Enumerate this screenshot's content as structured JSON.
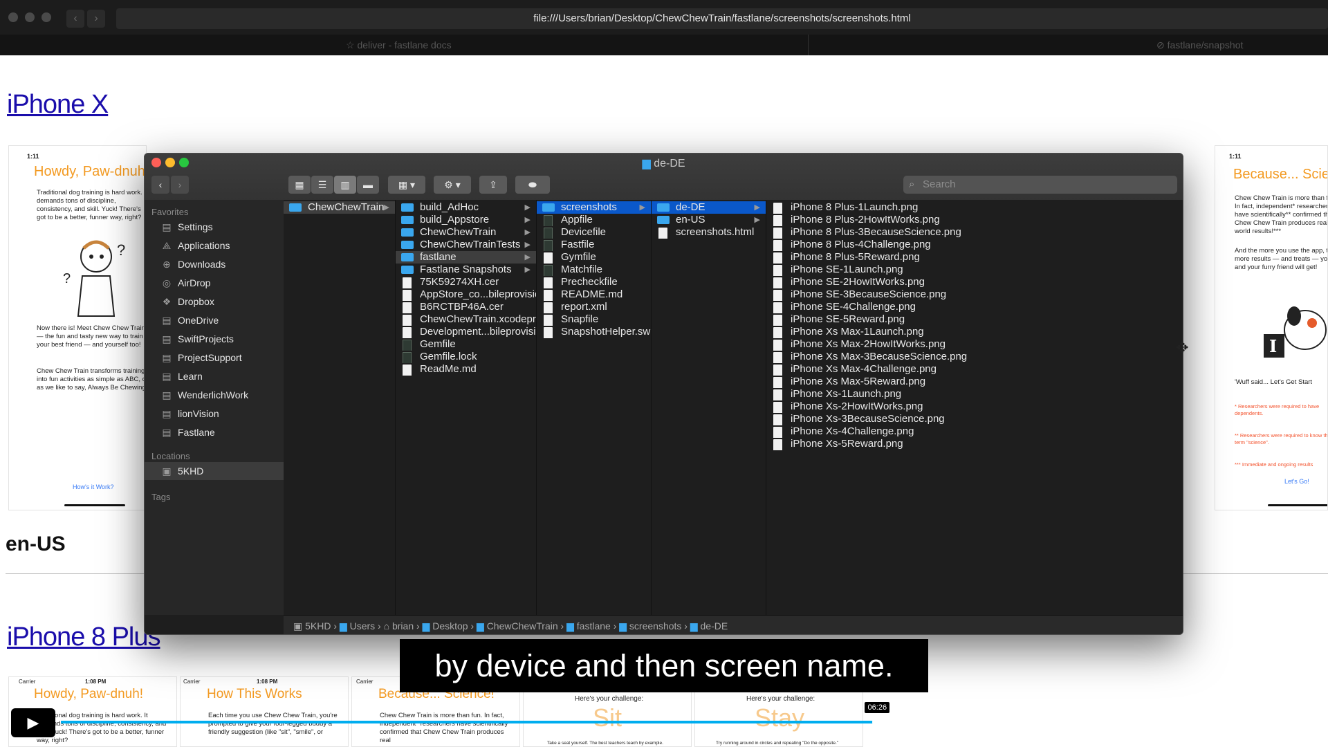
{
  "browser": {
    "url": "file:///Users/brian/Desktop/ChewChewTrain/fastlane/screenshots/screenshots.html",
    "tabs": [
      {
        "label": "deliver - fastlane docs"
      },
      {
        "label": "fastlane/snapshot"
      }
    ]
  },
  "page": {
    "section1_title": "iPhone X",
    "section2_title": "en-US",
    "section3_title": "iPhone 8 Plus",
    "cards_top": [
      {
        "time": "1:11",
        "title": "Howdy, Paw-dnuh",
        "para1": "Traditional dog training is hard work. It demands tons of discipline, consistency, and skill. Yuck! There's got to be a better, funner way, right?",
        "para2": "Now there is! Meet Chew Chew Train — the fun and tasty new way to train your best friend — and yourself too!",
        "para3": "Chew Chew Train transforms training into fun activities as simple as ABC, or as we like to say, Always Be Chewing!",
        "link": "How's it Work?"
      },
      {
        "time": "1:11",
        "title": "Because... Scie",
        "para1": "Chew Chew Train is more than fun. In fact, independent* researchers have scientifically** confirmed that Chew Chew Train produces real world results!***",
        "para2": "And the more you use the app, the more results — and treats — you and your furry friend will get!",
        "quote": "'Wuff said... Let's Get Start",
        "note1": "* Researchers were required to have dependents.",
        "note2": "** Researchers were required to know the term \"science\".",
        "note3": "*** Immediate and ongoing results",
        "link": "Let's Go!"
      }
    ],
    "cards_bottom": [
      {
        "carrier": "Carrier",
        "time": "1:08 PM",
        "title": "Howdy, Paw-dnuh!",
        "text": "Traditional dog training is hard work. It demands tons of discipline, consistency, and skill. Yuck! There's got to be a better, funner way, right?"
      },
      {
        "carrier": "Carrier",
        "time": "1:08 PM",
        "title": "How This Works",
        "text": "Each time you use Chew Chew Train, you're prompted to give your four-legged buddy a friendly suggestion (like \"sit\", \"smile\", or"
      },
      {
        "carrier": "Carrier",
        "time": "",
        "title": "Because... Science!",
        "text": "Chew Chew Train is more than fun. In fact, independent* researchers have scientifically** confirmed that Chew Chew Train produces real"
      },
      {
        "header": "Here's your challenge:",
        "big": "Sit",
        "foot": "Take a seat yourself. The best teachers teach by example."
      },
      {
        "header": "Here's your challenge:",
        "big": "Stay",
        "foot": "Try running around in circles and repeating \"Do the opposite.\""
      }
    ]
  },
  "finder": {
    "title": "de-DE",
    "search_placeholder": "Search",
    "sidebar": {
      "favorites_label": "Favorites",
      "favorites": [
        "Settings",
        "Applications",
        "Downloads",
        "AirDrop",
        "Dropbox",
        "OneDrive",
        "SwiftProjects",
        "ProjectSupport",
        "Learn",
        "WenderlichWork",
        "lionVision",
        "Fastlane"
      ],
      "locations_label": "Locations",
      "locations": [
        "5KHD"
      ],
      "tags_label": "Tags"
    },
    "col1": [
      {
        "name": "ChewChewTrain",
        "type": "folder",
        "arrow": true,
        "state": "gray"
      }
    ],
    "col2": [
      {
        "name": "build_AdHoc",
        "type": "folder",
        "arrow": true
      },
      {
        "name": "build_Appstore",
        "type": "folder",
        "arrow": true
      },
      {
        "name": "ChewChewTrain",
        "type": "folder",
        "arrow": true
      },
      {
        "name": "ChewChewTrainTests",
        "type": "folder",
        "arrow": true
      },
      {
        "name": "fastlane",
        "type": "folder",
        "arrow": true,
        "state": "gray"
      },
      {
        "name": "Fastlane Snapshots",
        "type": "folder",
        "arrow": true
      },
      {
        "name": "75K59274XH.cer",
        "type": "doc"
      },
      {
        "name": "AppStore_co...bileprovision",
        "type": "doc"
      },
      {
        "name": "B6RCTBP46A.cer",
        "type": "doc"
      },
      {
        "name": "ChewChewTrain.xcodeproj",
        "type": "doc"
      },
      {
        "name": "Development...bileprovision",
        "type": "doc"
      },
      {
        "name": "Gemfile",
        "type": "gdoc"
      },
      {
        "name": "Gemfile.lock",
        "type": "gdoc"
      },
      {
        "name": "ReadMe.md",
        "type": "doc"
      }
    ],
    "col3": [
      {
        "name": "screenshots",
        "type": "folder",
        "arrow": true,
        "state": "blue"
      },
      {
        "name": "Appfile",
        "type": "gdoc"
      },
      {
        "name": "Devicefile",
        "type": "gdoc"
      },
      {
        "name": "Fastfile",
        "type": "gdoc"
      },
      {
        "name": "Gymfile",
        "type": "doc"
      },
      {
        "name": "Matchfile",
        "type": "gdoc"
      },
      {
        "name": "Precheckfile",
        "type": "doc"
      },
      {
        "name": "README.md",
        "type": "doc"
      },
      {
        "name": "report.xml",
        "type": "doc"
      },
      {
        "name": "Snapfile",
        "type": "doc"
      },
      {
        "name": "SnapshotHelper.swift",
        "type": "doc"
      }
    ],
    "col4": [
      {
        "name": "de-DE",
        "type": "folder",
        "arrow": true,
        "state": "blue"
      },
      {
        "name": "en-US",
        "type": "folder",
        "arrow": true
      },
      {
        "name": "screenshots.html",
        "type": "doc"
      }
    ],
    "col5": [
      {
        "name": "iPhone 8 Plus-1Launch.png",
        "type": "doc"
      },
      {
        "name": "iPhone 8 Plus-2HowItWorks.png",
        "type": "doc"
      },
      {
        "name": "iPhone 8 Plus-3BecauseScience.png",
        "type": "doc"
      },
      {
        "name": "iPhone 8 Plus-4Challenge.png",
        "type": "doc"
      },
      {
        "name": "iPhone 8 Plus-5Reward.png",
        "type": "doc"
      },
      {
        "name": "iPhone SE-1Launch.png",
        "type": "doc"
      },
      {
        "name": "iPhone SE-2HowItWorks.png",
        "type": "doc"
      },
      {
        "name": "iPhone SE-3BecauseScience.png",
        "type": "doc"
      },
      {
        "name": "iPhone SE-4Challenge.png",
        "type": "doc"
      },
      {
        "name": "iPhone SE-5Reward.png",
        "type": "doc"
      },
      {
        "name": "iPhone Xs Max-1Launch.png",
        "type": "doc"
      },
      {
        "name": "iPhone Xs Max-2HowItWorks.png",
        "type": "doc"
      },
      {
        "name": "iPhone Xs Max-3BecauseScience.png",
        "type": "doc"
      },
      {
        "name": "iPhone Xs Max-4Challenge.png",
        "type": "doc"
      },
      {
        "name": "iPhone Xs Max-5Reward.png",
        "type": "doc"
      },
      {
        "name": "iPhone Xs-1Launch.png",
        "type": "doc"
      },
      {
        "name": "iPhone Xs-2HowItWorks.png",
        "type": "doc"
      },
      {
        "name": "iPhone Xs-3BecauseScience.png",
        "type": "doc"
      },
      {
        "name": "iPhone Xs-4Challenge.png",
        "type": "doc"
      },
      {
        "name": "iPhone Xs-5Reward.png",
        "type": "doc"
      }
    ],
    "path": [
      "5KHD",
      "Users",
      "brian",
      "Desktop",
      "ChewChewTrain",
      "fastlane",
      "screenshots",
      "de-DE"
    ]
  },
  "player": {
    "caption": "by device and then screen name.",
    "time": "06:26",
    "progress": 0.725,
    "icons": [
      "play-icon",
      "volume-icon",
      "cc-icon",
      "settings-icon",
      "miniplayer-icon",
      "fullscreen-icon"
    ]
  },
  "colors": {
    "accent": "#0a58ca",
    "folder": "#3aa7ee",
    "progress": "#00adef",
    "card_title": "#f39a21"
  }
}
